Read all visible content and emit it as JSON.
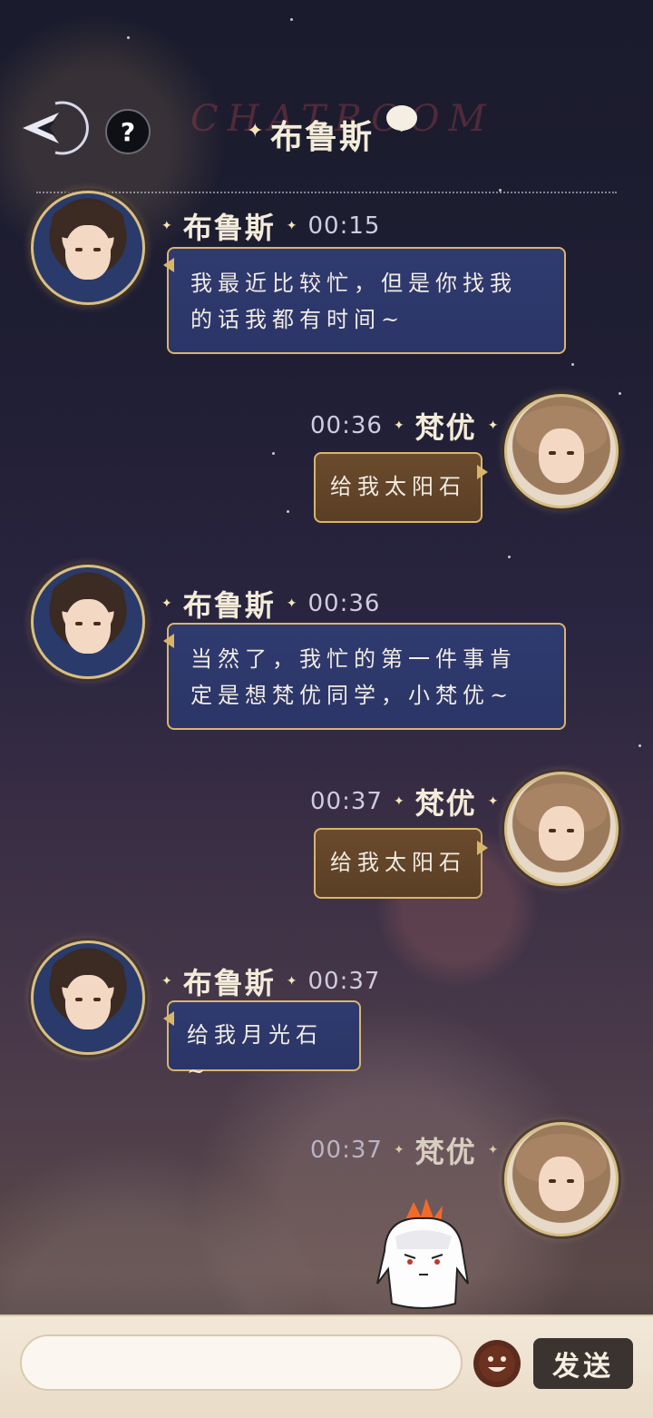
{
  "header": {
    "title": "布鲁斯",
    "watermark": "CHATROOM",
    "help_label": "?"
  },
  "messages": [
    {
      "side": "left",
      "name": "布鲁斯",
      "time": "00:15",
      "text": "我最近比较忙，但是你找我的话我都有时间~",
      "avatar": "bruce"
    },
    {
      "side": "right",
      "name": "梵优",
      "time": "00:36",
      "text": "给我太阳石",
      "avatar": "fanyou"
    },
    {
      "side": "left",
      "name": "布鲁斯",
      "time": "00:36",
      "text": "当然了，我忙的第一件事肯定是想梵优同学，小梵优~",
      "avatar": "bruce"
    },
    {
      "side": "right",
      "name": "梵优",
      "time": "00:37",
      "text": "给我太阳石",
      "avatar": "fanyou"
    },
    {
      "side": "left",
      "name": "布鲁斯",
      "time": "00:37",
      "text": "给我月光石~",
      "avatar": "bruce"
    },
    {
      "side": "right",
      "name": "梵优",
      "time": "00:37",
      "text": "",
      "avatar": "fanyou"
    }
  ],
  "input": {
    "placeholder": "",
    "send_label": "发送"
  },
  "icons": {
    "back": "back-arrow-icon",
    "help": "question-icon",
    "emoji": "emoji-icon",
    "chat": "chat-bubble-icon",
    "mascot": "mascot-icon"
  },
  "colors": {
    "bubble_left": "#2f3a6f",
    "bubble_right": "#6b4a2c",
    "bubble_border": "#d9b56c",
    "name_text": "#f4ecd9",
    "send_button": "#3a3330"
  }
}
